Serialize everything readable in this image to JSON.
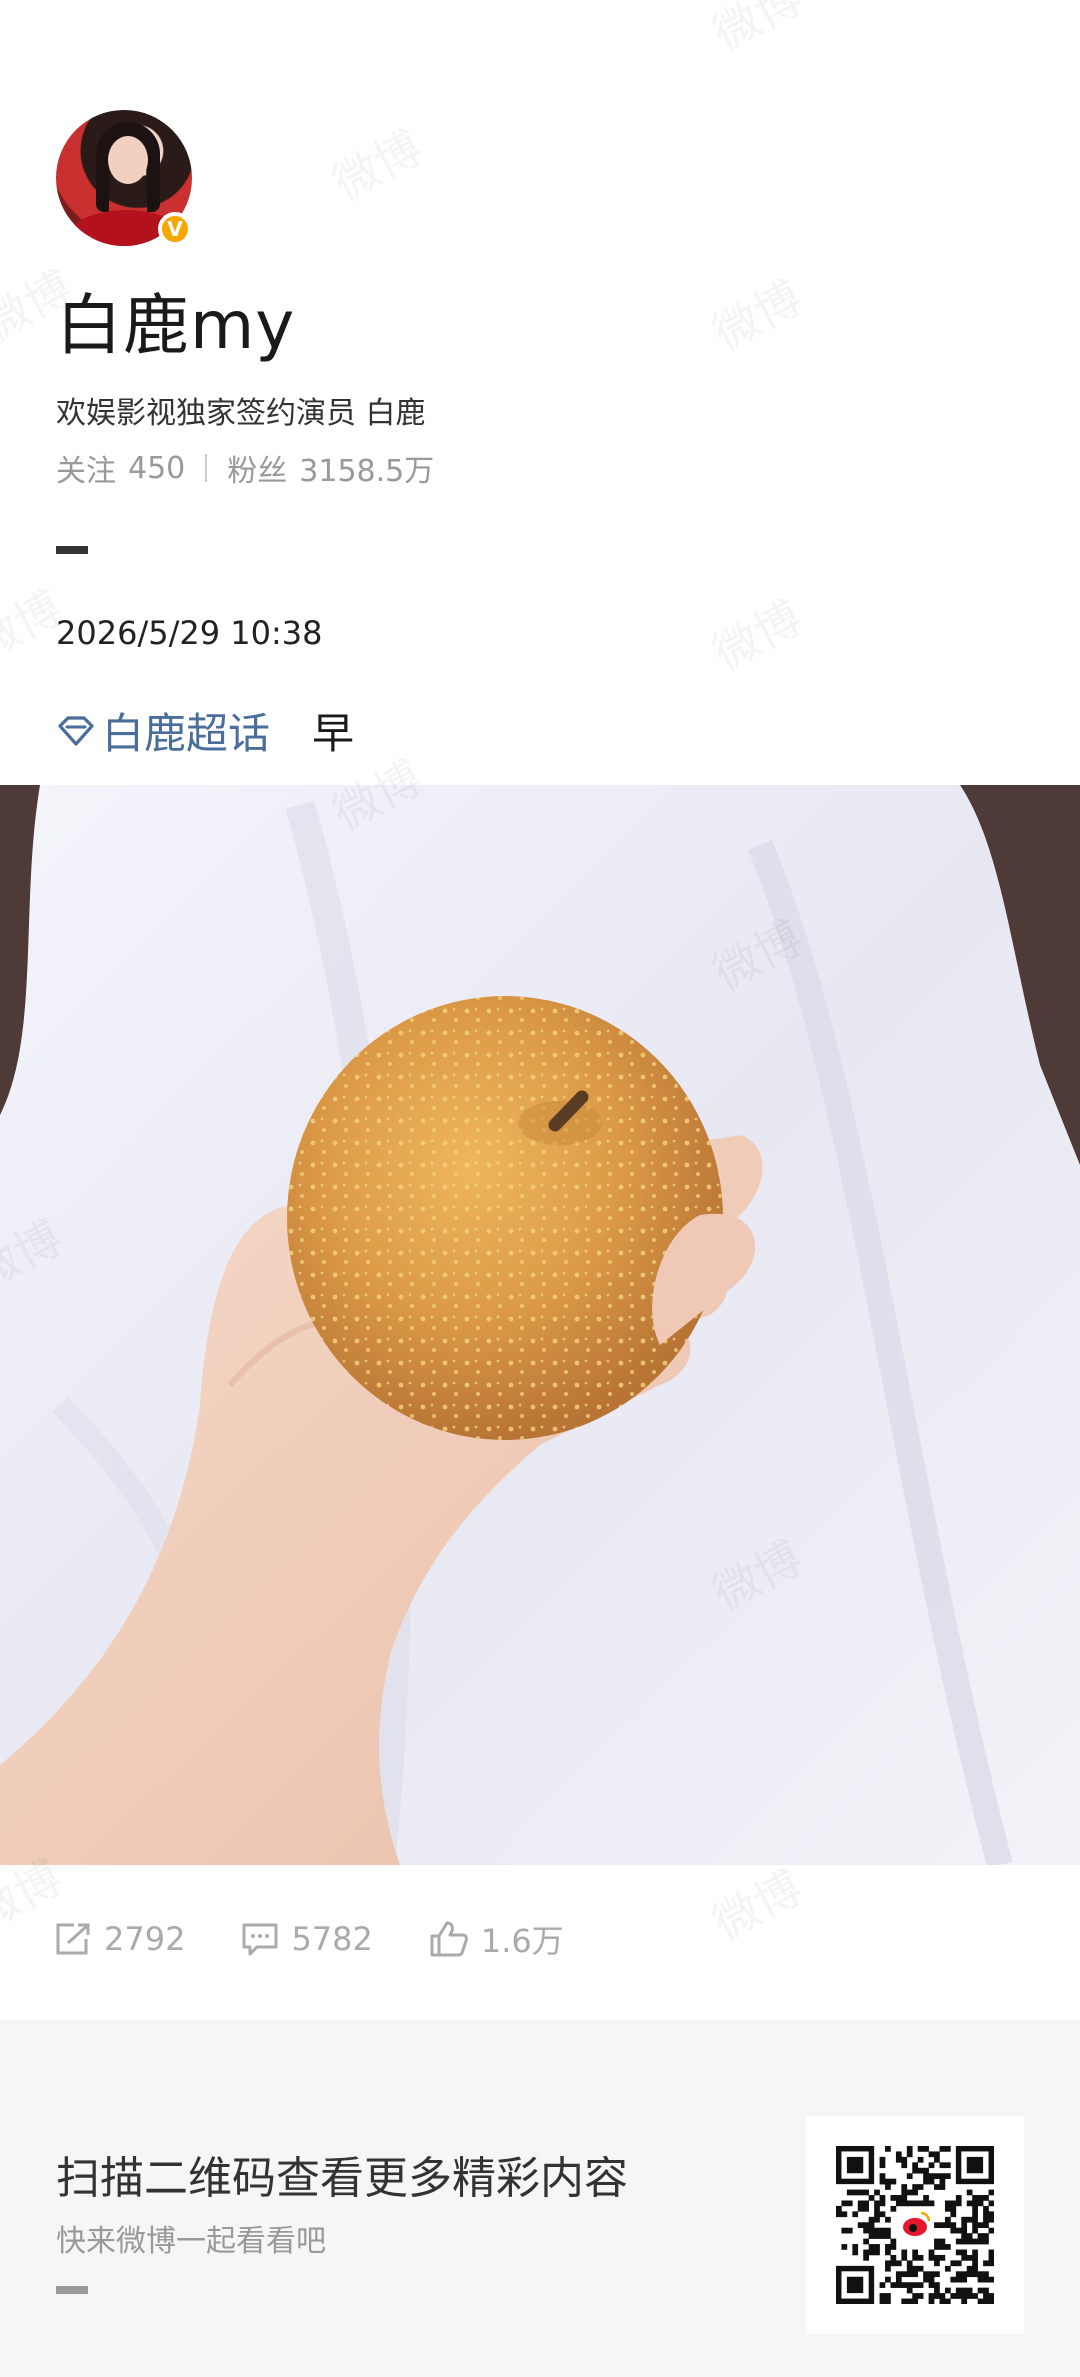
{
  "profile": {
    "username": "白鹿my",
    "verified_badge": "V",
    "bio": "欢娱影视独家签约演员 白鹿",
    "following_label": "关注",
    "following_count": "450",
    "followers_label": "粉丝",
    "followers_count": "3158.5万"
  },
  "post": {
    "timestamp": "2026/5/29 10:38",
    "topic_icon": "diamond-topic-icon",
    "topic": "白鹿超话",
    "text": "早",
    "image_subject": "photo-pear-in-hand"
  },
  "actions": {
    "repost_count": "2792",
    "comment_count": "5782",
    "like_count": "1.6万"
  },
  "promo": {
    "title": "扫描二维码查看更多精彩内容",
    "subtitle": "快来微博一起看看吧",
    "qr_icon": "weibo-qr-code"
  },
  "watermark_text": "微博",
  "colors": {
    "topic_link": "#4a6e9c",
    "verified_badge": "#f7a600",
    "muted_text": "#999999",
    "promo_bg": "#f6f6f6"
  }
}
